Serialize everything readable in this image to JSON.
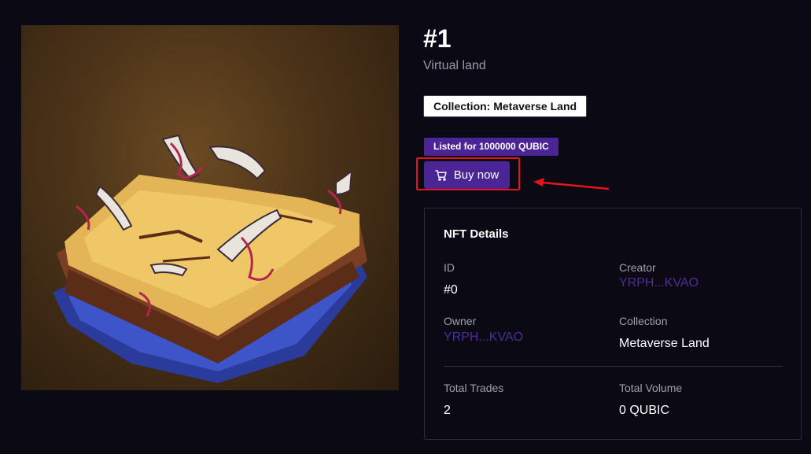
{
  "nft": {
    "title": "#1",
    "subtitle": "Virtual land",
    "collection_badge": "Collection: Metaverse Land",
    "listed_badge": "Listed for 1000000 QUBIC",
    "buy_button_label": "Buy now",
    "image_alt": "Floating desert island with ruins"
  },
  "details": {
    "heading": "NFT Details",
    "id_label": "ID",
    "id_value": "#0",
    "creator_label": "Creator",
    "creator_value": "YRPH...KVAO",
    "owner_label": "Owner",
    "owner_value": "YRPH...KVAO",
    "collection_label": "Collection",
    "collection_value": "Metaverse Land",
    "total_trades_label": "Total Trades",
    "total_trades_value": "2",
    "total_volume_label": "Total Volume",
    "total_volume_value": "0 QUBIC"
  },
  "icons": {
    "cart": "shopping-cart-icon",
    "arrow": "red-arrow-annotation"
  },
  "colors": {
    "background": "#0b0a14",
    "accent_purple": "#4b2596",
    "link_purple": "#4e2d98",
    "highlight_red": "#e5141b"
  }
}
